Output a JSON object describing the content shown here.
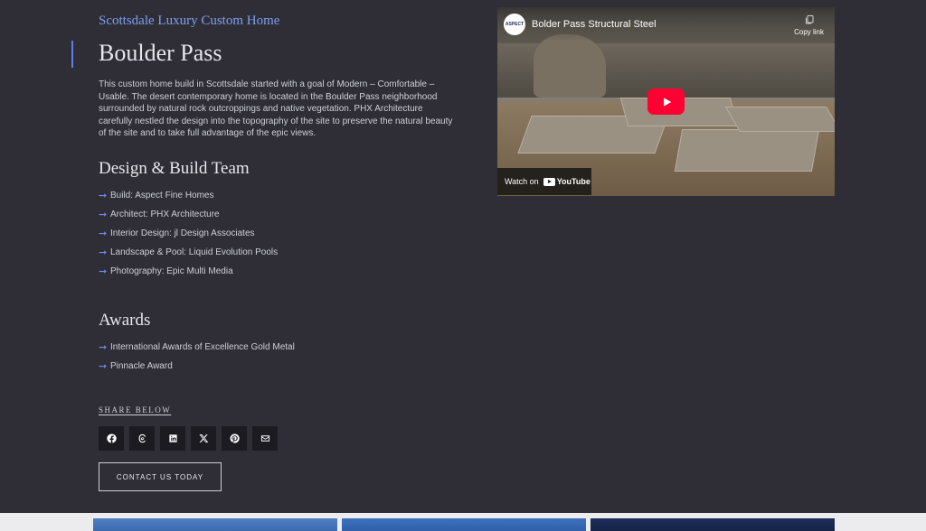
{
  "header": {
    "eyebrow": "Scottsdale Luxury Custom Home",
    "title": "Boulder Pass"
  },
  "intro": "This custom home build in Scottsdale started with a goal of Modern – Comfortable – Usable. The desert contemporary home is located in the Boulder Pass neighborhood surrounded by natural rock outcroppings and native vegetation. PHX Architecture carefully nestled the design into the topography of the site to preserve the natural beauty of the site and to take full advantage of the epic views.",
  "team": {
    "heading": "Design & Build Team",
    "items": [
      "Build: Aspect Fine Homes",
      "Architect: PHX Architecture",
      "Interior Design: jl Design Associates",
      "Landscape & Pool: Liquid Evolution Pools",
      "Photography: Epic Multi Media"
    ]
  },
  "awards": {
    "heading": "Awards",
    "items": [
      "International Awards of Excellence Gold Metal",
      "Pinnacle Award"
    ]
  },
  "share": {
    "label": "SHARE BELOW",
    "icons": [
      "facebook-icon",
      "threads-icon",
      "linkedin-icon",
      "x-icon",
      "pinterest-icon",
      "email-icon"
    ]
  },
  "cta": {
    "label": "CONTACT US TODAY"
  },
  "video": {
    "title": "Bolder Pass Structural Steel",
    "channel_logo_text": "ASPECT",
    "copy_link_label": "Copy link",
    "watch_on_label": "Watch on",
    "youtube_label": "YouTube"
  },
  "colors": {
    "background": "#2f2e37",
    "accent": "#7f9ef0",
    "play_button": "#ff0033"
  }
}
